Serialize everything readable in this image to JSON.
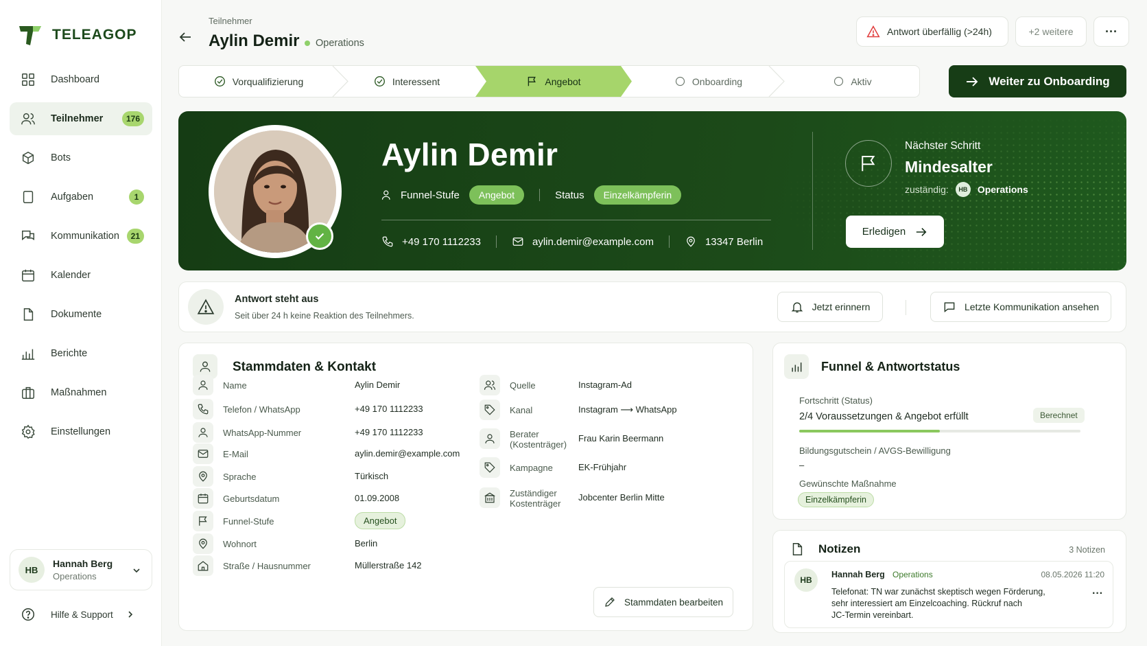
{
  "app": {
    "name": "TELEAGOP"
  },
  "sidebar": {
    "items": [
      {
        "label": "Dashboard",
        "icon": "grid-icon"
      },
      {
        "label": "Teilnehmer",
        "icon": "users-icon",
        "badge": "176",
        "active": true
      },
      {
        "label": "Bots",
        "icon": "bot-icon"
      },
      {
        "label": "Aufgaben",
        "icon": "clipboard-icon",
        "badge": "1"
      },
      {
        "label": "Kommunikation",
        "icon": "chat-icon",
        "badge": "21"
      },
      {
        "label": "Kalender",
        "icon": "calendar-icon"
      },
      {
        "label": "Dokumente",
        "icon": "document-icon"
      },
      {
        "label": "Berichte",
        "icon": "bar-chart-icon"
      },
      {
        "label": "Maßnahmen",
        "icon": "briefcase-icon"
      },
      {
        "label": "Einstellungen",
        "icon": "gear-icon"
      }
    ],
    "user": {
      "initials": "HB",
      "name": "Hannah Berg",
      "role": "Operations"
    },
    "help": "Hilfe & Support"
  },
  "header": {
    "breadcrumb": "Teilnehmer",
    "title": "Aylin Demir",
    "team": "Operations",
    "alert_label": "Antwort überfällig (>24h)",
    "more_label": "+2 weitere",
    "menu_label": "···"
  },
  "stepper": {
    "steps": [
      {
        "label": "Vorqualifizierung",
        "state": "done"
      },
      {
        "label": "Interessent",
        "state": "done"
      },
      {
        "label": "Angebot",
        "state": "active"
      },
      {
        "label": "Onboarding",
        "state": "todo"
      },
      {
        "label": "Aktiv",
        "state": "todo"
      }
    ],
    "next_label": "Weiter zu Onboarding"
  },
  "hero": {
    "name": "Aylin Demir",
    "funnel_label": "Funnel-Stufe",
    "funnel_value": "Angebot",
    "status_label": "Status",
    "status_value": "Einzelkämpferin",
    "phone": "+49 170 1112233",
    "email": "aylin.demir@example.com",
    "location": "13347 Berlin",
    "next_step_label": "Nächster Schritt",
    "next_step_title": "Mindesalter",
    "owner_label": "zuständig:",
    "owner_initials": "HB",
    "owner_name": "Operations",
    "done_label": "Erledigen"
  },
  "alert": {
    "title": "Antwort steht aus",
    "subtitle": "Seit über 24 h keine Reaktion des Teilnehmers.",
    "remind_label": "Jetzt erinnern",
    "last_comm_label": "Letzte Kommunikation ansehen"
  },
  "stammdaten": {
    "title": "Stammdaten & Kontakt",
    "left": [
      {
        "label": "Name",
        "value": "Aylin Demir",
        "icon": "user-icon"
      },
      {
        "label": "Telefon / WhatsApp",
        "value": "+49 170 1112233",
        "icon": "phone-icon"
      },
      {
        "label": "WhatsApp-Nummer",
        "value": "+49 170 1112233",
        "icon": "user-icon"
      },
      {
        "label": "E-Mail",
        "value": "aylin.demir@example.com",
        "icon": "mail-icon"
      },
      {
        "label": "Sprache",
        "value": "Türkisch",
        "icon": "pin-icon"
      },
      {
        "label": "Geburtsdatum",
        "value": "01.09.2008",
        "icon": "calendar-icon"
      },
      {
        "label": "Funnel-Stufe",
        "value": "Angebot",
        "icon": "flag-icon"
      },
      {
        "label": "Wohnort",
        "value": "Berlin",
        "icon": "pin-icon"
      },
      {
        "label": "Straße / Hausnummer",
        "value": "Müllerstraße 142",
        "icon": "home-icon"
      }
    ],
    "right": [
      {
        "label": "Quelle",
        "value": "Instagram-Ad",
        "icon": "users-icon"
      },
      {
        "label": "Kanal",
        "value": "Instagram ⟶ WhatsApp",
        "icon": "tag-icon"
      },
      {
        "label1": "Berater",
        "label2": "(Kostenträger)",
        "value": "Frau Karin Beermann",
        "icon": "user-icon"
      },
      {
        "label": "Kampagne",
        "value": "EK-Frühjahr",
        "icon": "tag-icon"
      },
      {
        "label1": "Zuständiger",
        "label2": "Kostenträger",
        "value": "Jobcenter Berlin Mitte",
        "icon": "building-icon"
      }
    ],
    "edit_label": "Stammdaten bearbeiten"
  },
  "funnel": {
    "title": "Funnel & Antwortstatus",
    "progress_label": "Fortschritt (Status)",
    "progress_value": "2/4 Voraussetzungen & Angebot erfüllt",
    "progress_fraction": 0.5,
    "progress_tag": "Berechnet",
    "voucher_label": "Bildungsgutschein / AVGS-Bewilligung",
    "voucher_value": "–",
    "measure_label": "Gewünschte Maßnahme",
    "measure_value": "Einzelkämpferin"
  },
  "notes": {
    "title": "Notizen",
    "count": "3 Notizen",
    "items": [
      {
        "initials": "HB",
        "author": "Hannah Berg",
        "team": "Operations",
        "date": "08.05.2026 11:20",
        "line1": "Telefonat: TN war zunächst skeptisch wegen Förderung,",
        "line2": "sehr interessiert am Einzelcoaching. Rückruf nach",
        "line3": "JC-Termin vereinbart."
      }
    ]
  },
  "colors": {
    "brand": "#173d16",
    "accent": "#a6d56b",
    "pill": "#7dc05a"
  }
}
